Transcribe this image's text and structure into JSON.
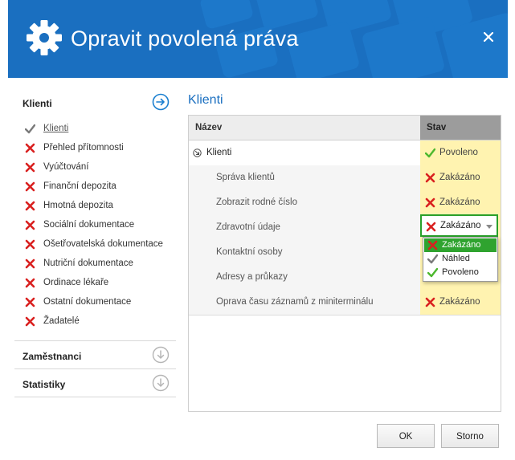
{
  "window": {
    "title": "Opravit povolená práva"
  },
  "sidebar": {
    "sections": [
      {
        "label": "Klienti",
        "expanded": true
      },
      {
        "label": "Zaměstnanci",
        "expanded": false
      },
      {
        "label": "Statistiky",
        "expanded": false
      }
    ],
    "items": [
      {
        "label": "Klienti",
        "state": "check-gray",
        "active": true
      },
      {
        "label": "Přehled přítomnosti",
        "state": "cross"
      },
      {
        "label": "Vyúčtování",
        "state": "cross"
      },
      {
        "label": "Finanční depozita",
        "state": "cross"
      },
      {
        "label": "Hmotná depozita",
        "state": "cross"
      },
      {
        "label": "Sociální dokumentace",
        "state": "cross"
      },
      {
        "label": "Ošetřovatelská dokumentace",
        "state": "cross"
      },
      {
        "label": "Nutriční dokumentace",
        "state": "cross"
      },
      {
        "label": "Ordinace lékaře",
        "state": "cross"
      },
      {
        "label": "Ostatní dokumentace",
        "state": "cross"
      },
      {
        "label": "Žadatelé",
        "state": "cross"
      }
    ]
  },
  "main": {
    "title": "Klienti",
    "columns": {
      "name": "Název",
      "state": "Stav"
    },
    "rows": [
      {
        "name": "Klienti",
        "state": "Povoleno",
        "state_icon": "check-green",
        "level": 0
      },
      {
        "name": "Správa klientů",
        "state": "Zakázáno",
        "state_icon": "cross",
        "level": 1
      },
      {
        "name": "Zobrazit rodné číslo",
        "state": "Zakázáno",
        "state_icon": "cross",
        "level": 1
      },
      {
        "name": "Zdravotní údaje",
        "state": "Zakázáno",
        "state_icon": "cross",
        "level": 1,
        "editing": true
      },
      {
        "name": "Kontaktní osoby",
        "state": "",
        "state_icon": "",
        "level": 1
      },
      {
        "name": "Adresy a průkazy",
        "state": "",
        "state_icon": "",
        "level": 1
      },
      {
        "name": "Oprava času záznamů z miniterminálu",
        "state": "Zakázáno",
        "state_icon": "cross",
        "level": 1
      }
    ],
    "dropdown": {
      "selected": "Zakázáno",
      "options": [
        {
          "label": "Zakázáno",
          "icon": "cross"
        },
        {
          "label": "Náhled",
          "icon": "check-gray"
        },
        {
          "label": "Povoleno",
          "icon": "check-green"
        }
      ]
    }
  },
  "footer": {
    "ok_label": "OK",
    "cancel_label": "Storno"
  },
  "colors": {
    "accent": "#1a6fc0",
    "state_bg": "#fff3b0",
    "dropdown_border": "#2aa02a",
    "cross": "#d9201f",
    "check_green": "#4cb82e"
  }
}
